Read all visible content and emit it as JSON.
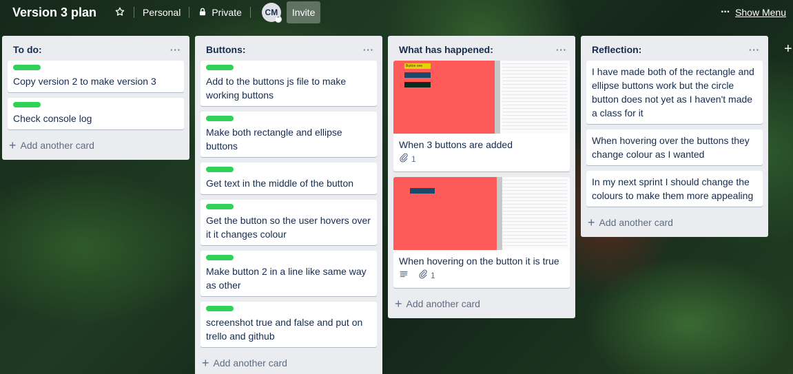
{
  "header": {
    "title": "Version 3 plan",
    "star_icon": "star-icon",
    "workspace_label": "Personal",
    "visibility_icon": "lock-icon",
    "visibility_label": "Private",
    "avatar_initials": "CM",
    "invite_label": "Invite",
    "menu_dots": "···",
    "show_menu_label": "Show Menu"
  },
  "colors": {
    "label_green": "#2fd157",
    "list_bg": "#ebecf0",
    "cover_red": "#ff5a5a"
  },
  "lists": [
    {
      "title": "To do:",
      "menu": "···",
      "cards": [
        {
          "text": "Copy version 2 to make version 3"
        },
        {
          "text": "Check console log"
        }
      ],
      "add_card": "Add another card"
    },
    {
      "title": "Buttons:",
      "menu": "···",
      "cards": [
        {
          "text": "Add to the buttons js file to make working buttons"
        },
        {
          "text": "Make both rectangle and ellipse buttons"
        },
        {
          "text": "Get text in the middle of the button"
        },
        {
          "text": "Get the button so the user hovers over it it changes colour"
        },
        {
          "text": "Make button 2 in a line like same way as other"
        },
        {
          "text": "screenshot true and false and put on trello and github"
        }
      ],
      "add_card": "Add another card"
    },
    {
      "title": "What has happened:",
      "menu": "···",
      "cards": [
        {
          "text": "When 3 buttons are added",
          "attachments": "1",
          "cover_label": "Button one"
        },
        {
          "text": "When hovering on the button it is true",
          "attachments": "1"
        }
      ],
      "add_card": "Add another card"
    },
    {
      "title": "Reflection:",
      "menu": "···",
      "cards": [
        {
          "text": "I have made both of the rectangle and ellipse buttons work but the circle button does not yet as I haven't made a class for it"
        },
        {
          "text": "When hovering over the buttons they change colour as I wanted"
        },
        {
          "text": "In my next sprint I should change the colours to make them more appealing"
        }
      ],
      "add_card": "Add another card"
    }
  ],
  "add_list": "+"
}
